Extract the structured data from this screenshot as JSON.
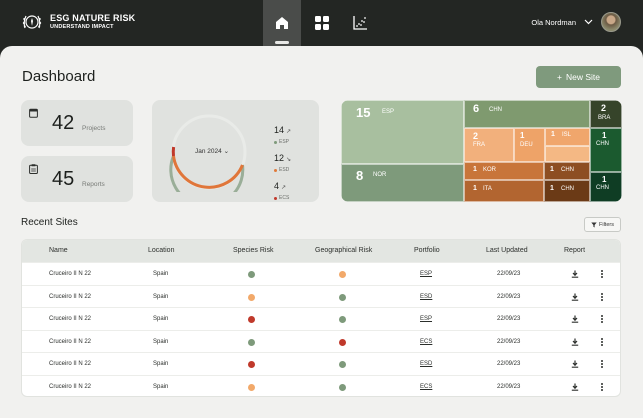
{
  "brand": {
    "title": "ESG NATURE RISK",
    "subtitle": "UNDERSTAND IMPACT"
  },
  "nav": {
    "items": [
      "home-icon",
      "grid-icon",
      "scatter-chart-icon"
    ],
    "active": "home-icon"
  },
  "user": {
    "name": "Ola Nordman"
  },
  "page": {
    "title": "Dashboard",
    "new_site_label": "New Site"
  },
  "stats": [
    {
      "value": "42",
      "label": "Projects",
      "icon": "calendar-icon"
    },
    {
      "value": "45",
      "label": "Reports",
      "icon": "clipboard-icon"
    }
  ],
  "period": {
    "label": "Jan 2024",
    "legend": [
      {
        "value": "14",
        "code": "ESP",
        "color": "#7e9a7b"
      },
      {
        "value": "12",
        "code": "ESD",
        "color": "#e07a3a"
      },
      {
        "value": "4",
        "code": "ECS",
        "color": "#c0392b"
      }
    ]
  },
  "treemap": [
    {
      "num": "15",
      "code": "ESP"
    },
    {
      "num": "6",
      "code": "CHN"
    },
    {
      "num": "2",
      "code": "BRA"
    },
    {
      "num": "1",
      "code": "CHN"
    },
    {
      "num": "1",
      "code": "CHN"
    },
    {
      "num": "8",
      "code": "NOR"
    },
    {
      "num": "2",
      "code": "FRA"
    },
    {
      "num": "1",
      "code": "DEU"
    },
    {
      "num": "1",
      "code": "ISL"
    },
    {
      "num": "1",
      "code": "KOR"
    },
    {
      "num": "1",
      "code": "CHN"
    },
    {
      "num": "1",
      "code": "ITA"
    },
    {
      "num": "1",
      "code": "CHN"
    }
  ],
  "recent": {
    "title": "Recent Sites",
    "filters_label": "Filters"
  },
  "table": {
    "headers": [
      "Name",
      "Location",
      "Species Risk",
      "Geographical Risk",
      "Portfolio",
      "Last Updated",
      "Report"
    ],
    "rows": [
      {
        "name": "Cruceiro II N 22",
        "location": "Spain",
        "species": "green",
        "geo": "orange",
        "portfolio": "ESP",
        "updated": "22/09/23"
      },
      {
        "name": "Cruceiro II N 22",
        "location": "Spain",
        "species": "orange",
        "geo": "green",
        "portfolio": "ESD",
        "updated": "22/09/23"
      },
      {
        "name": "Cruceiro II N 22",
        "location": "Spain",
        "species": "red",
        "geo": "green",
        "portfolio": "ESP",
        "updated": "22/09/23"
      },
      {
        "name": "Cruceiro II N 22",
        "location": "Spain",
        "species": "green",
        "geo": "red",
        "portfolio": "ECS",
        "updated": "22/09/23"
      },
      {
        "name": "Cruceiro II N 22",
        "location": "Spain",
        "species": "red",
        "geo": "green",
        "portfolio": "ESD",
        "updated": "22/09/23"
      },
      {
        "name": "Cruceiro II N 22",
        "location": "Spain",
        "species": "orange",
        "geo": "green",
        "portfolio": "ECS",
        "updated": "22/09/23"
      }
    ]
  },
  "colors": {
    "accent": "#7f9a7d",
    "green": "#7e9a7b",
    "orange": "#f2a96a",
    "red": "#c0392b",
    "dark_green": "#0f3d24"
  }
}
